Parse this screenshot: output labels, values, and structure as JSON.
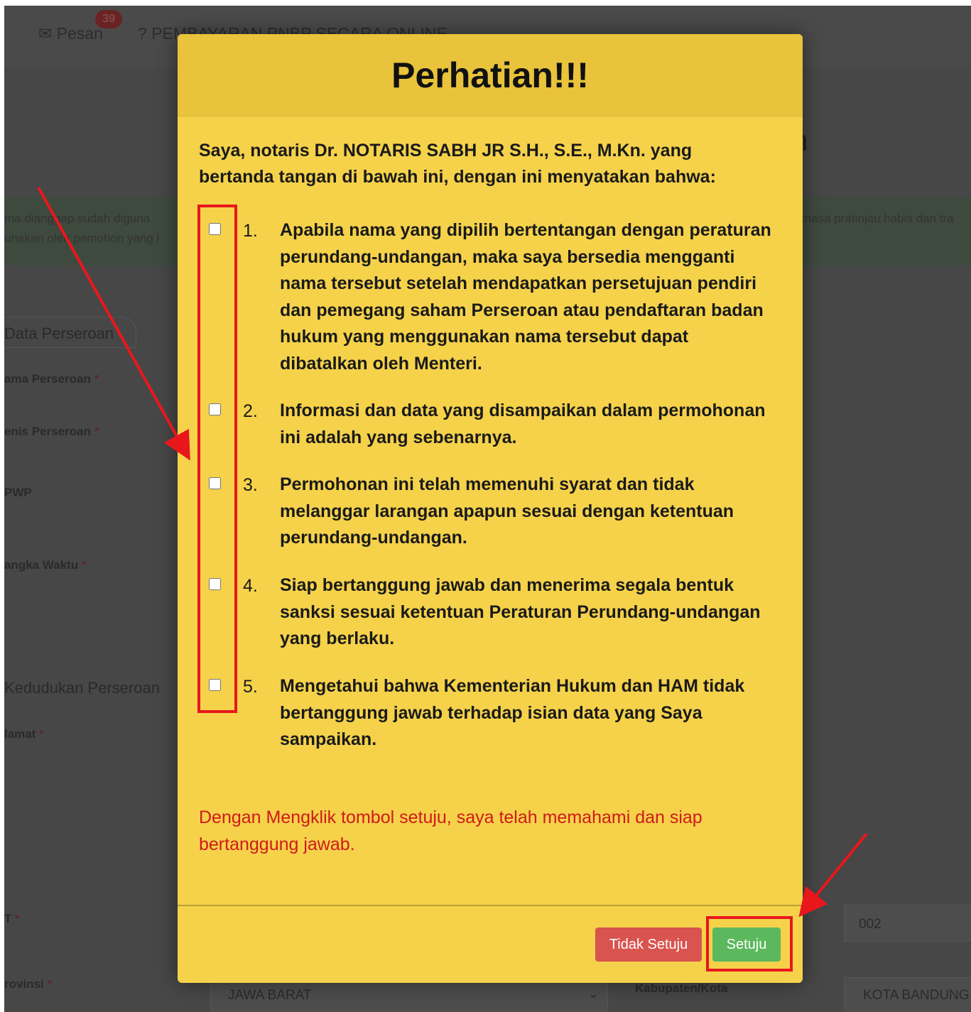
{
  "background": {
    "topbar": {
      "messages_label": "Pesan",
      "messages_badge": "39",
      "payment_label": "PEMBAYARAN PNBP SECARA ONLINE"
    },
    "title_fragment": "n",
    "alert": {
      "line1_left": "ma dianggap sudah diguna",
      "line2_left": "unakan oleh pemohon yang l",
      "line1_right": "masa pratinjau habis dan tra"
    },
    "section1_tab": "Data Perseroan",
    "labels": {
      "nama": "ama Perseroan",
      "jenis": "enis Perseroan",
      "npwp": "PWP",
      "jangka": "angka Waktu",
      "alamat": "lamat",
      "rt": "T",
      "provinsi": "rovinsi",
      "kabupaten": "Kabupaten/Kota"
    },
    "section2_tab": "Kedudukan Perseroan",
    "rt_value": "002",
    "provinsi_value": "JAWA BARAT",
    "kota_value": "KOTA BANDUNG"
  },
  "modal": {
    "title": "Perhatian!!!",
    "intro": "Saya, notaris Dr. NOTARIS SABH JR S.H., S.E., M.Kn. yang bertanda tangan di bawah ini, dengan ini menyatakan bahwa:",
    "items": [
      {
        "num": "1.",
        "text": "Apabila nama yang dipilih bertentangan dengan peraturan perundang-undangan, maka saya bersedia mengganti nama tersebut setelah mendapatkan persetujuan pendiri dan pemegang saham Perseroan atau pendaftaran badan hukum yang menggunakan nama tersebut dapat dibatalkan oleh Menteri."
      },
      {
        "num": "2.",
        "text": "Informasi dan data yang disampaikan dalam permohonan ini adalah yang sebenarnya."
      },
      {
        "num": "3.",
        "text": "Permohonan ini telah memenuhi syarat dan tidak melanggar larangan apapun sesuai dengan ketentuan perundang-undangan."
      },
      {
        "num": "4.",
        "text": "Siap bertanggung jawab dan menerima segala bentuk sanksi sesuai ketentuan Peraturan Perundang-undangan yang berlaku."
      },
      {
        "num": "5.",
        "text": "Mengetahui bahwa Kementerian Hukum dan HAM tidak bertanggung jawab terhadap isian data yang Saya sampaikan."
      }
    ],
    "notice": "Dengan Mengklik tombol setuju, saya telah memahami dan siap bertanggung jawab.",
    "buttons": {
      "disagree": "Tidak Setuju",
      "agree": "Setuju"
    }
  },
  "colors": {
    "modal_bg": "#f5d24a",
    "modal_header": "#e8c33b",
    "notice_text": "#d11a1a",
    "btn_disagree": "#d9534f",
    "btn_agree": "#5cb85c",
    "annotation": "#e8171c"
  }
}
